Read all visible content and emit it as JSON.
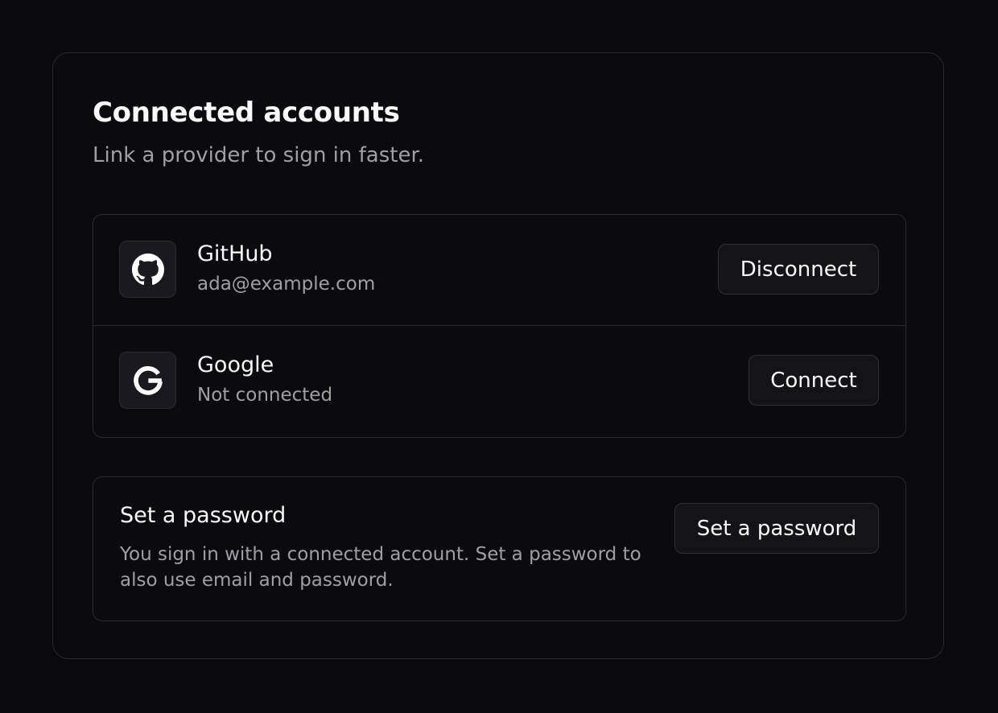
{
  "header": {
    "title": "Connected accounts",
    "subtitle": "Link a provider to sign in faster."
  },
  "providers": [
    {
      "name": "GitHub",
      "status": "ada@example.com",
      "icon": "github-icon",
      "action_label": "Disconnect"
    },
    {
      "name": "Google",
      "status": "Not connected",
      "icon": "google-icon",
      "action_label": "Connect"
    }
  ],
  "password": {
    "title": "Set a password",
    "description": "You sign in with a connected account. Set a password to also use email and password.",
    "button_label": "Set a password"
  },
  "colors": {
    "background": "#0a0a0c",
    "border": "#2a2a2f",
    "text_primary": "#fafafa",
    "text_secondary": "#9f9fa6"
  }
}
